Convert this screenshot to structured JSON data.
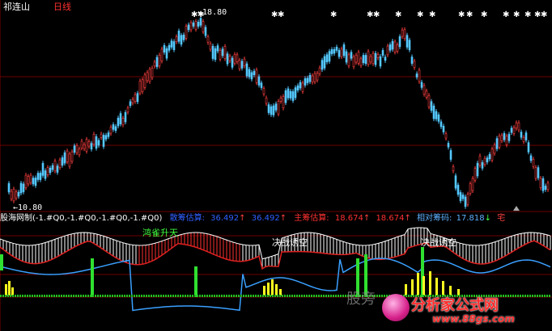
{
  "header": {
    "stock_name": "祁连山",
    "period": "日线"
  },
  "price_chart": {
    "high_label": "18.80",
    "low_label": "10.80",
    "high_label_prefix": "←",
    "low_label_prefix": "←"
  },
  "indicator_header": {
    "name": "股海网制(-1.#Q0,-1.#Q0,-1.#Q0,-1.#Q0)",
    "item1_label": "散筹估算:",
    "item1_value": "36.492",
    "item1_arrow": "↑",
    "item1_value2": "36.492",
    "item1_arrow2": "↑",
    "item2_label": "主筹估算:",
    "item2_value": "18.674",
    "item2_arrow": "↑",
    "item2_value2": "18.674",
    "item2_arrow2": "↑",
    "item3_label": "相对筹码:",
    "item3_value": "17.818",
    "item3_arrow": "↓",
    "item3_tail": "宅"
  },
  "annotations": {
    "a1": "鸿雀升天",
    "a2": "决战诱空",
    "a3": "决战诱空"
  },
  "watermark": "股旁",
  "logo": {
    "text": "分析家公式网",
    "url": "www.88gs.com"
  },
  "colors": {
    "up": "#ff4040",
    "down": "#54c8ff",
    "grid": "#8b0000",
    "axis": "#7a0000"
  }
}
